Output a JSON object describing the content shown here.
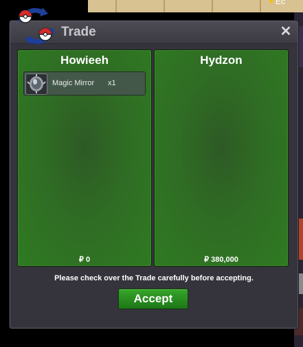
{
  "window": {
    "title": "Trade",
    "close_glyph": "✕"
  },
  "background": {
    "partial_label": "Ec"
  },
  "left_panel": {
    "player_name": "Howieeh",
    "items": [
      {
        "icon": "magic-mirror-icon",
        "name": "Magic Mirror",
        "quantity": "x1"
      }
    ],
    "money": "₽ 0"
  },
  "right_panel": {
    "player_name": "Hydzon",
    "items": [],
    "money": "₽ 380,000"
  },
  "footer": {
    "notice": "Please check over the Trade carefully before accepting.",
    "accept_label": "Accept"
  },
  "colors": {
    "panel_green": "#2f7a22",
    "accept_green": "#2a9420",
    "window_bg": "#35333b"
  }
}
